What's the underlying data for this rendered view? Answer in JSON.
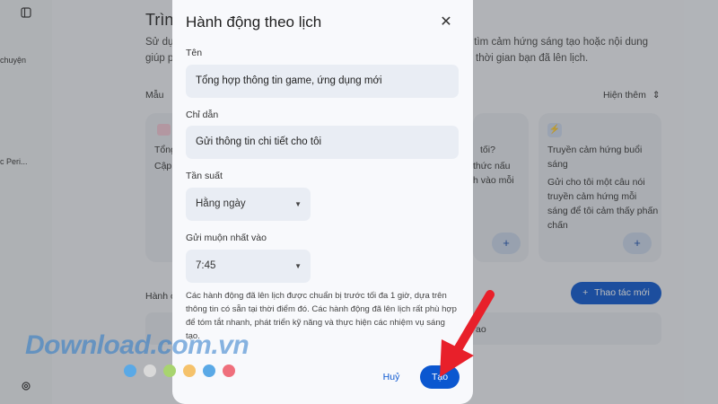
{
  "sidebar": {
    "item1": "chuyện",
    "item2": "c Peri..."
  },
  "background": {
    "title": "Trình",
    "desc_line1": "Sử dụ",
    "desc_line1b": "y, tìm cảm hứng sáng tạo hoặc nội dung",
    "desc_line2": "giúp p",
    "desc_line2b": "thời gian bạn đã lên lịch.",
    "templates_label": "Mẫu",
    "show_more": "Hiện thêm",
    "actions_label": "Hành ở",
    "new_action": "Thao tác mới",
    "card1_lines": [
      "Tổng",
      "Cập"
    ],
    "card2_lines": [
      "tối?",
      "thức nấu",
      "h vào mỗi"
    ],
    "card3_lines": [
      "Truyền cảm hứng buổi",
      "sáng",
      "Gửi cho tôi một câu nói",
      "truyền cảm hứng mỗi",
      "sáng để tôi cảm thấy phấn",
      "chấn"
    ],
    "row_fragment": "ao"
  },
  "dialog": {
    "title": "Hành động theo lịch",
    "name_label": "Tên",
    "name_value": "Tổng hợp thông tin game, ứng dụng mới",
    "instructions_label": "Chỉ dẫn",
    "instructions_value": "Gửi thông tin chi tiết cho tôi",
    "frequency_label": "Tần suất",
    "frequency_value": "Hằng ngày",
    "send_by_label": "Gửi muộn nhất vào",
    "send_by_value": "7:45",
    "info_text": "Các hành động đã lên lịch được chuẩn bị trước tối đa 1 giờ, dựa trên thông tin có sẵn tại thời điểm đó. Các hành động đã lên lịch rất phù hợp để tóm tắt nhanh, phát triển kỹ năng và thực hiện các nhiệm vụ sáng tạo.",
    "cancel_label": "Huỷ",
    "create_label": "Tạo"
  },
  "watermark": {
    "text": "Download.com.vn",
    "colors": [
      "#5aa9e6",
      "#d9d9d9",
      "#a8d46f",
      "#f5c26b",
      "#5aa9e6",
      "#ef6f7c"
    ]
  },
  "colors": {
    "accent": "#0b57d0",
    "arrow": "#e8202a"
  }
}
